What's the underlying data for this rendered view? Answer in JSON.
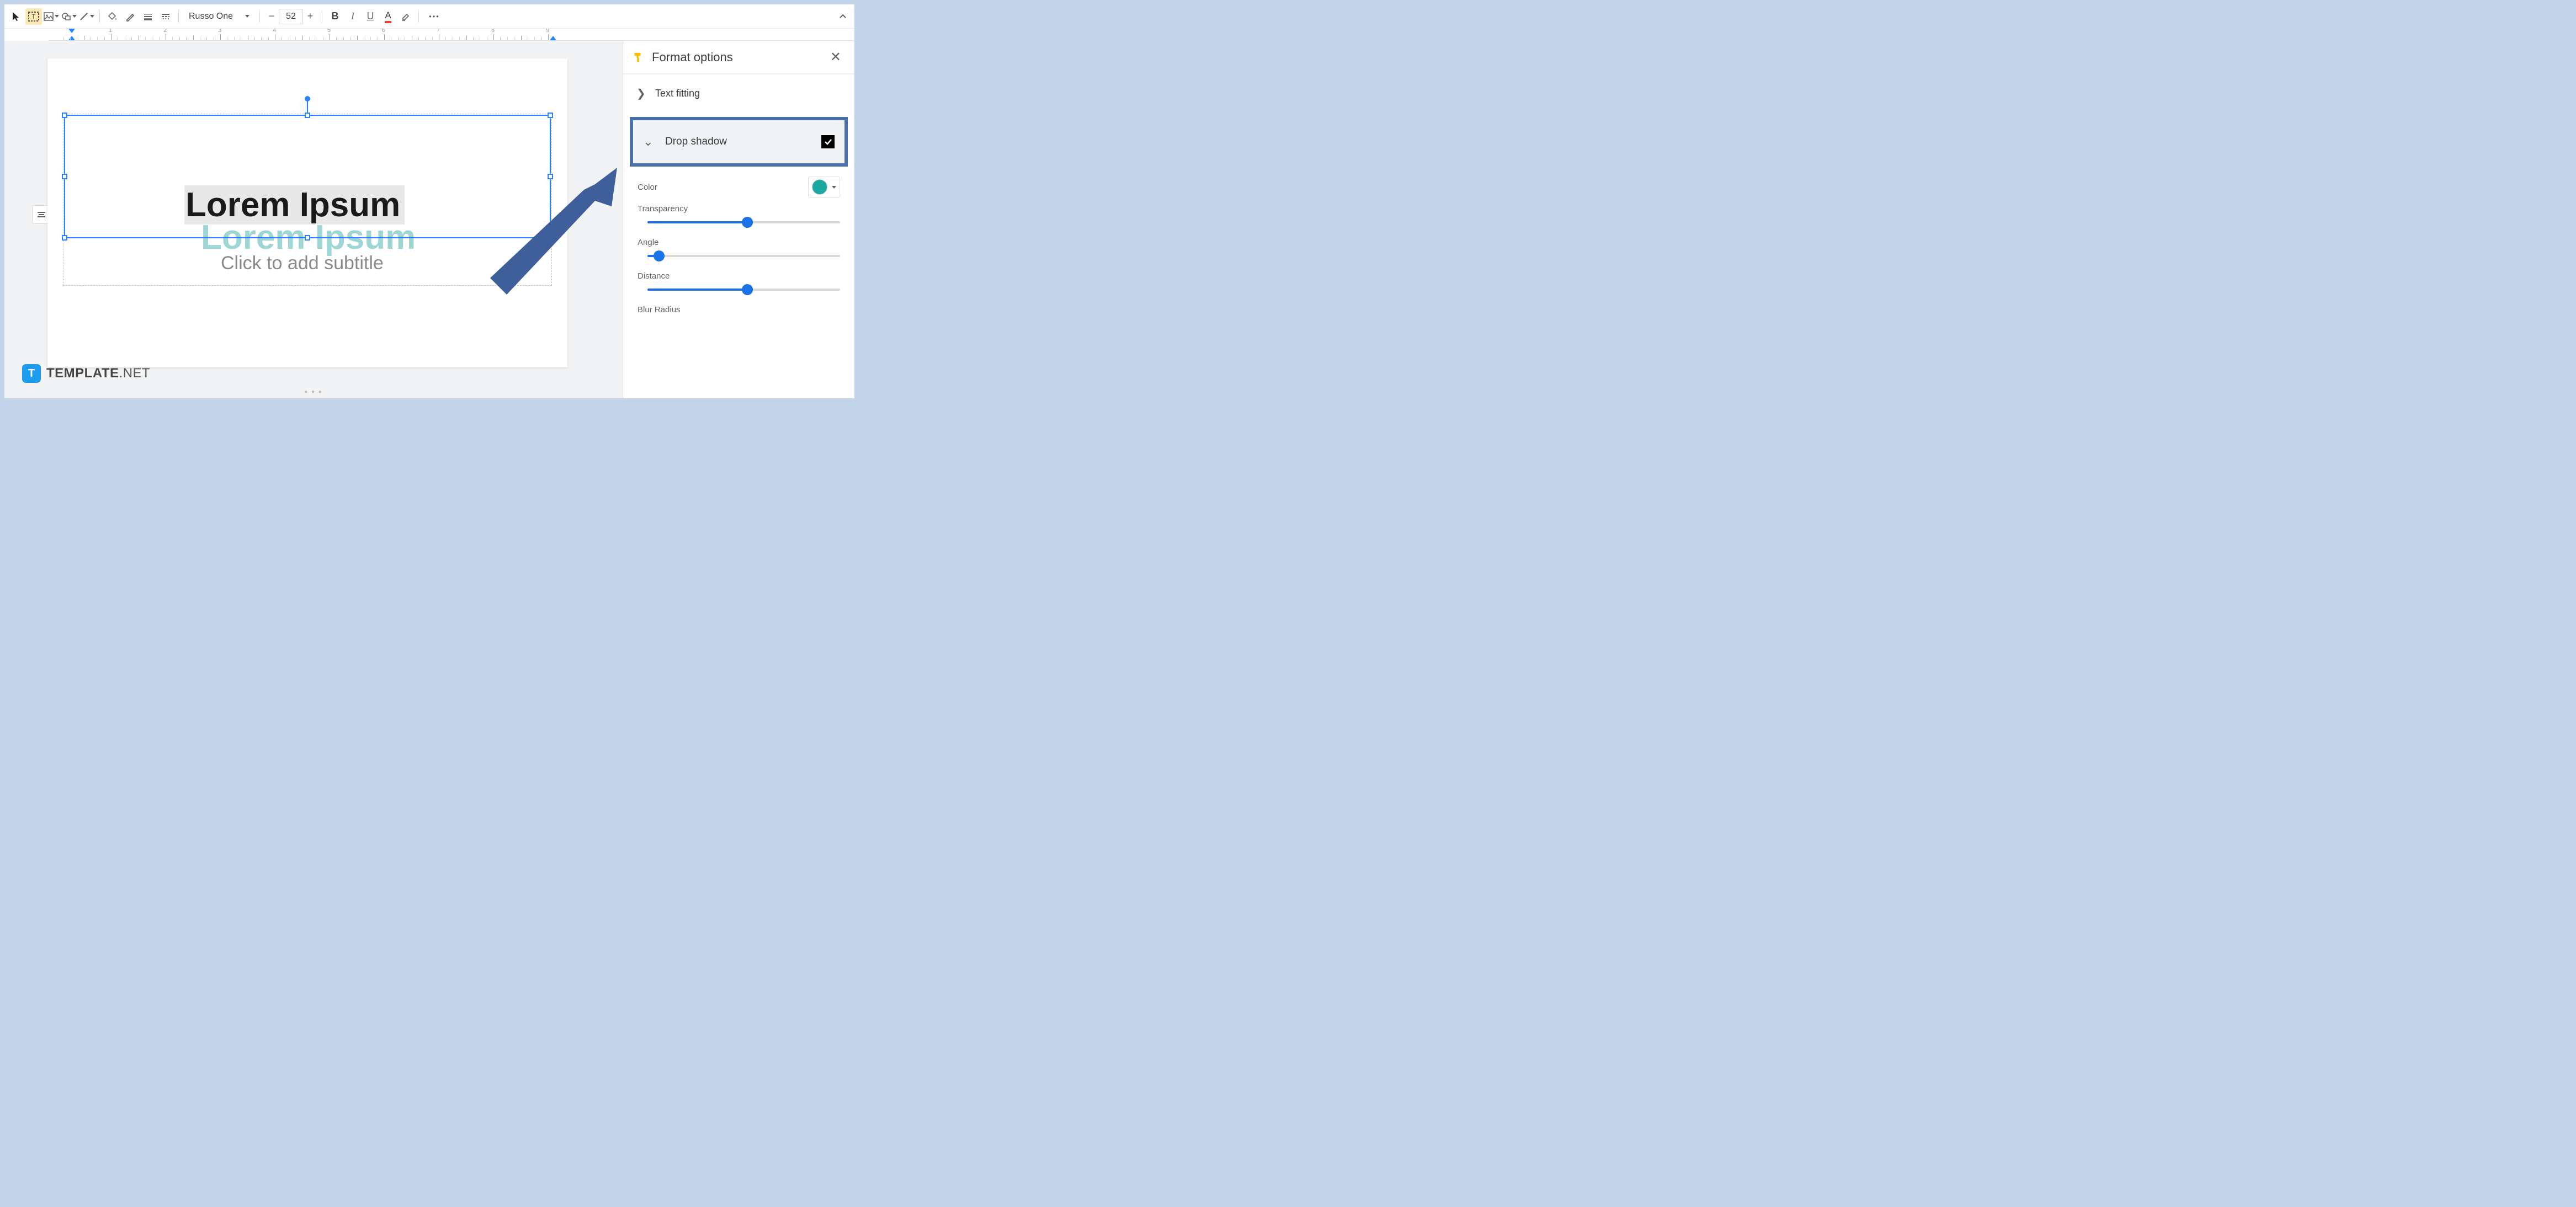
{
  "toolbar": {
    "font_name": "Russo One",
    "font_size": "52",
    "bold": "B",
    "italic": "I",
    "underline": "U",
    "text_color": "A",
    "minus": "−",
    "plus": "+",
    "more": "•••"
  },
  "ruler": {
    "majors": [
      1,
      2,
      3,
      4,
      5,
      6,
      7,
      8,
      9
    ]
  },
  "slide": {
    "title_text": "Lorem Ipsum",
    "shadow_text": "Lorem Ipsum",
    "subtitle_placeholder": "Click to add subtitle"
  },
  "panel": {
    "title": "Format options",
    "rows": {
      "text_fitting": "Text fitting",
      "drop_shadow": "Drop shadow"
    },
    "options": {
      "color": "Color",
      "transparency": "Transparency",
      "angle": "Angle",
      "distance": "Distance",
      "blur_radius": "Blur Radius"
    },
    "sliders": {
      "transparency_pct": 52,
      "angle_pct": 6,
      "distance_pct": 52
    },
    "drop_shadow_enabled": true,
    "color_swatch": "#1aa9a0"
  },
  "watermark": {
    "icon_letter": "T",
    "brand_bold": "TEMPLATE",
    "brand_light": ".NET"
  }
}
